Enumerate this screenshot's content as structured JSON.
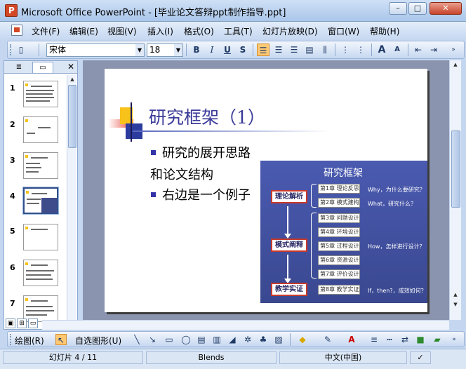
{
  "window": {
    "title": "Microsoft Office PowerPoint - [毕业论文答辩ppt制作指导.ppt]",
    "min": "–",
    "max": "□",
    "close": "✕"
  },
  "menu": [
    "文件(F)",
    "编辑(E)",
    "视图(V)",
    "插入(I)",
    "格式(O)",
    "工具(T)",
    "幻灯片放映(D)",
    "窗口(W)",
    "帮助(H)"
  ],
  "format_toolbar": {
    "font": "宋体",
    "size": "18",
    "bold": "B",
    "italic": "I",
    "underline": "U",
    "shadow": "S",
    "grow_font": "A",
    "shrink_font": "A"
  },
  "slides_panel": {
    "close": "✕",
    "thumbnails": [
      "1",
      "2",
      "3",
      "4",
      "5",
      "6",
      "7"
    ],
    "selected": "4"
  },
  "slide": {
    "title": "研究框架（1）",
    "bullet1": "研究的展开思路",
    "line2": "和论文结构",
    "bullet2": "右边是一个例子"
  },
  "framework": {
    "title": "研究框架",
    "stages": [
      "理论解析",
      "模式阐释",
      "教学实证"
    ],
    "chapters": [
      "第1章 理论反思",
      "第2章 模式建构",
      "第3章 问题设计",
      "第4章 环境设计",
      "第5章 过程设计",
      "第6章 资源设计",
      "第7章 评价设计",
      "第8章 教学实证"
    ],
    "questions": [
      "Why，为什么要研究？",
      "What，研究什么？",
      "How，怎样进行设计？",
      "If，then?，成效如何？"
    ]
  },
  "draw_toolbar": {
    "draw": "绘图(R)",
    "autoshapes": "自选图形(U)"
  },
  "status": {
    "slide": "幻灯片 4 / 11",
    "design": "Blends",
    "language": "中文(中国)"
  }
}
